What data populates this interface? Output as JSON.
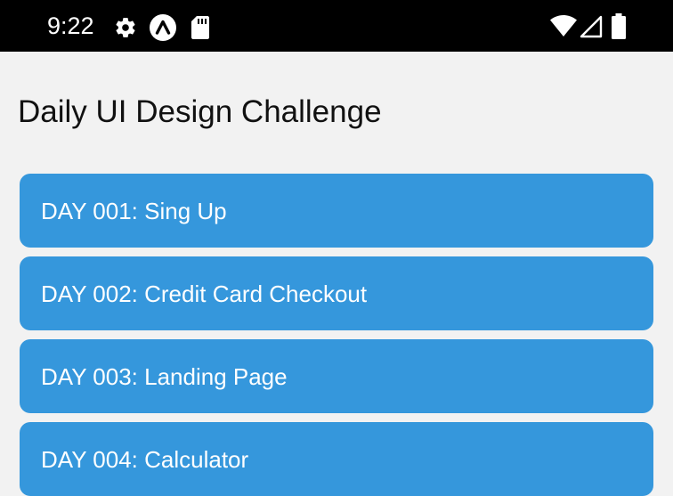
{
  "status_bar": {
    "time": "9:22",
    "icons_left": [
      "gear-icon",
      "arch-icon",
      "sd-card-icon"
    ],
    "icons_right": [
      "wifi-icon",
      "cell-signal-icon",
      "battery-icon"
    ],
    "background": "#000000"
  },
  "page": {
    "title": "Daily UI Design Challenge",
    "background": "#f2f2f2"
  },
  "list": {
    "item_color": "#3597dc",
    "items": [
      {
        "label": "DAY 001: Sing Up"
      },
      {
        "label": "DAY 002: Credit Card Checkout"
      },
      {
        "label": "DAY 003: Landing Page"
      },
      {
        "label": "DAY 004: Calculator"
      }
    ]
  }
}
